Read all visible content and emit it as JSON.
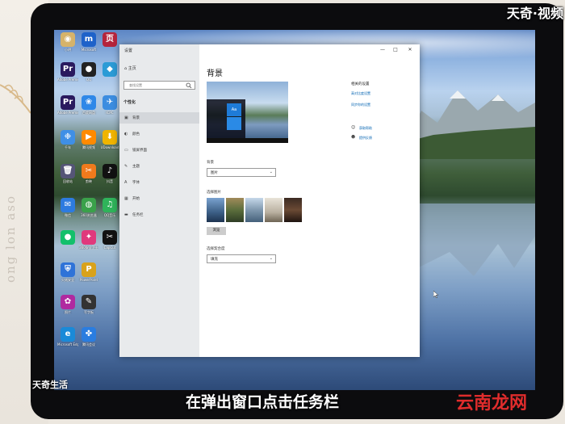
{
  "overlay": {
    "watermark_top": "天奇·视频",
    "logo_bottom": "天奇生活",
    "caption": "在弹出窗口点击任务栏",
    "site_mark": "云南龙网"
  },
  "background": {
    "paper_text": "ong lon aso"
  },
  "desktop": {
    "icons": [
      {
        "label": "小明",
        "glyph": "◉",
        "color": "#d6b36a"
      },
      {
        "label": "Microsoft",
        "glyph": "m",
        "color": "#1e62c9"
      },
      {
        "label": "",
        "glyph": "页",
        "color": "#b4243c"
      },
      {
        "label": "Adobe Premiere",
        "glyph": "Pr",
        "color": "#2a1a5e"
      },
      {
        "label": "QQ",
        "glyph": "●",
        "color": "#222"
      },
      {
        "label": "",
        "glyph": "◆",
        "color": "#2b9bd6"
      },
      {
        "label": "Adobe Premie...",
        "glyph": "Pr",
        "color": "#2a1a5e"
      },
      {
        "label": "百度网盘",
        "glyph": "❀",
        "color": "#2e88e8"
      },
      {
        "label": "ICPC",
        "glyph": "✈",
        "color": "#3c8de0"
      },
      {
        "label": "千年",
        "glyph": "❉",
        "color": "#3f8fe6"
      },
      {
        "label": "腾讯视频",
        "glyph": "▶",
        "color": "#ff8a00"
      },
      {
        "label": "UDownload",
        "glyph": "⬇",
        "color": "#f0b400"
      },
      {
        "label": "回收站",
        "glyph": "🗑",
        "color": "#557"
      },
      {
        "label": "剪映",
        "glyph": "✂",
        "color": "#f07a1c"
      },
      {
        "label": "抖音",
        "glyph": "♪",
        "color": "#111"
      },
      {
        "label": "微信",
        "glyph": "✉",
        "color": "#2d7be0"
      },
      {
        "label": "360浏览器",
        "glyph": "◍",
        "color": "#3aa14a"
      },
      {
        "label": "QQ音乐",
        "glyph": "♫",
        "color": "#2fb35a"
      },
      {
        "label": "",
        "glyph": "●",
        "color": "#13c06b"
      },
      {
        "label": "360安全卫士",
        "glyph": "✦",
        "color": "#e0397c"
      },
      {
        "label": "CapCut",
        "glyph": "✂",
        "color": "#111"
      },
      {
        "label": "火绒安全",
        "glyph": "⛨",
        "color": "#2f73d8"
      },
      {
        "label": "PowerPoint",
        "glyph": "P",
        "color": "#d9a21b"
      },
      {
        "label": "",
        "glyph": "",
        "color": "#000"
      },
      {
        "label": "照片",
        "glyph": "✿",
        "color": "#b02aa0"
      },
      {
        "label": "写字板",
        "glyph": "✎",
        "color": "#333"
      },
      {
        "label": "",
        "glyph": "",
        "color": "#000"
      },
      {
        "label": "Microsoft Edge",
        "glyph": "e",
        "color": "#1a8ad8"
      },
      {
        "label": "腾讯会议",
        "glyph": "✤",
        "color": "#2a7de0"
      }
    ]
  },
  "window": {
    "title": "设置",
    "minimize": "—",
    "maximize": "□",
    "close": "✕",
    "home": "主页",
    "search_placeholder": "查找设置",
    "section": "个性化",
    "nav": [
      {
        "label": "背景",
        "icon": "▣",
        "active": true
      },
      {
        "label": "颜色",
        "icon": "◐",
        "active": false
      },
      {
        "label": "锁屏界面",
        "icon": "▭",
        "active": false
      },
      {
        "label": "主题",
        "icon": "✎",
        "active": false
      },
      {
        "label": "字体",
        "icon": "A",
        "active": false
      },
      {
        "label": "开始",
        "icon": "▦",
        "active": false
      },
      {
        "label": "任务栏",
        "icon": "▬",
        "active": false
      }
    ],
    "page_title": "背景",
    "preview_tile": "Aa",
    "background_label": "背景",
    "background_value": "图片",
    "choose_picture_label": "选择图片",
    "browse": "浏览",
    "fit_label": "选择契合度",
    "fit_value": "填充",
    "related_title": "相关的设置",
    "related_links": [
      "高对比度设置",
      "同步你的设置"
    ],
    "help_links": [
      "获取帮助",
      "提供反馈"
    ],
    "chevron": "⌄"
  }
}
